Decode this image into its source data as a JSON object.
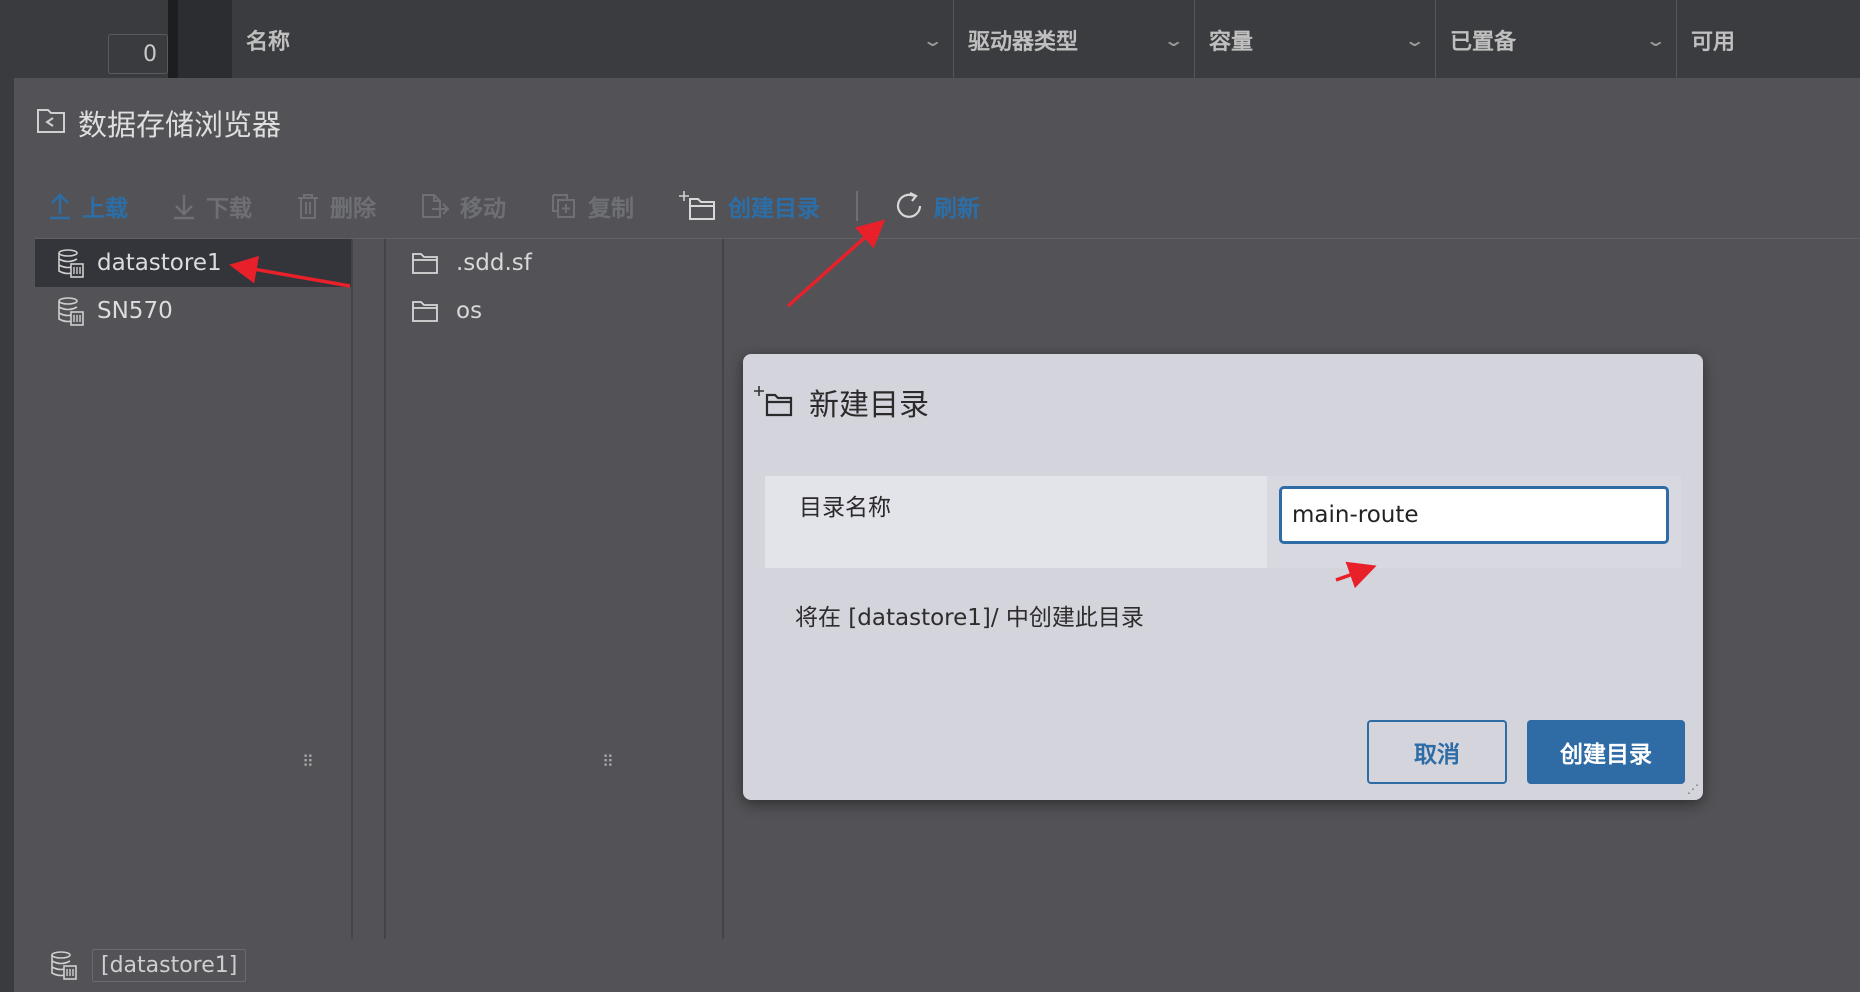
{
  "background": {
    "counter": "0",
    "columns": [
      {
        "label": "名称"
      },
      {
        "label": "驱动器类型"
      },
      {
        "label": "容量"
      },
      {
        "label": "已置备"
      },
      {
        "label": "可用"
      }
    ]
  },
  "browser": {
    "title": "数据存储浏览器",
    "toolbar": {
      "upload": "上载",
      "download": "下载",
      "delete": "删除",
      "move": "移动",
      "copy": "复制",
      "mkdir": "创建目录",
      "refresh": "刷新"
    },
    "datastores": [
      {
        "name": "datastore1",
        "selected": true
      },
      {
        "name": "SN570",
        "selected": false
      }
    ],
    "files": [
      {
        "name": ".sdd.sf"
      },
      {
        "name": "os"
      }
    ],
    "status_path": "[datastore1]"
  },
  "dialog": {
    "title": "新建目录",
    "field_label": "目录名称",
    "field_value": "main-route",
    "note": "将在 [datastore1]/ 中创建此目录",
    "cancel": "取消",
    "create": "创建目录"
  },
  "colors": {
    "accent": "#2f6ca6",
    "annotation": "#e8202a"
  }
}
